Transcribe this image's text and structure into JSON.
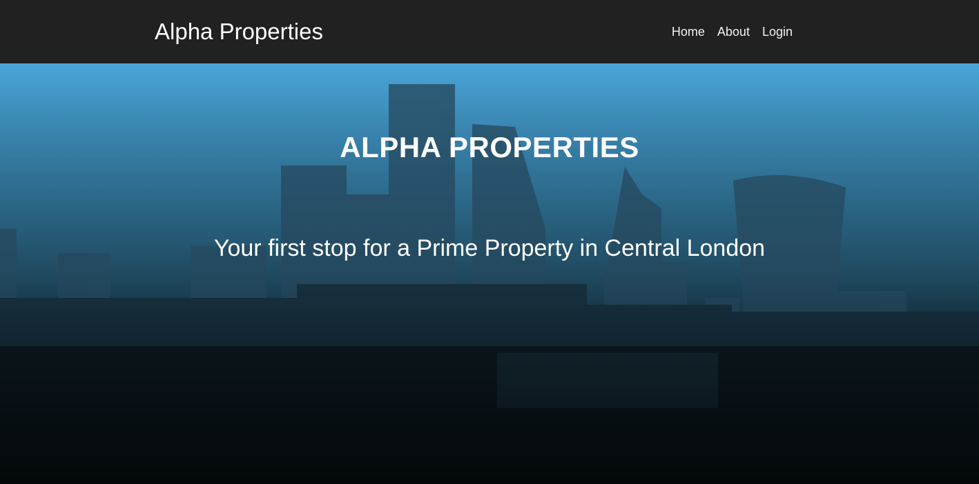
{
  "navbar": {
    "brand": "Alpha Properties",
    "links": [
      {
        "label": "Home"
      },
      {
        "label": "About"
      },
      {
        "label": "Login"
      }
    ]
  },
  "hero": {
    "title": "ALPHA PROPERTIES",
    "subtitle": "Your first stop for a Prime Property in Central London"
  }
}
